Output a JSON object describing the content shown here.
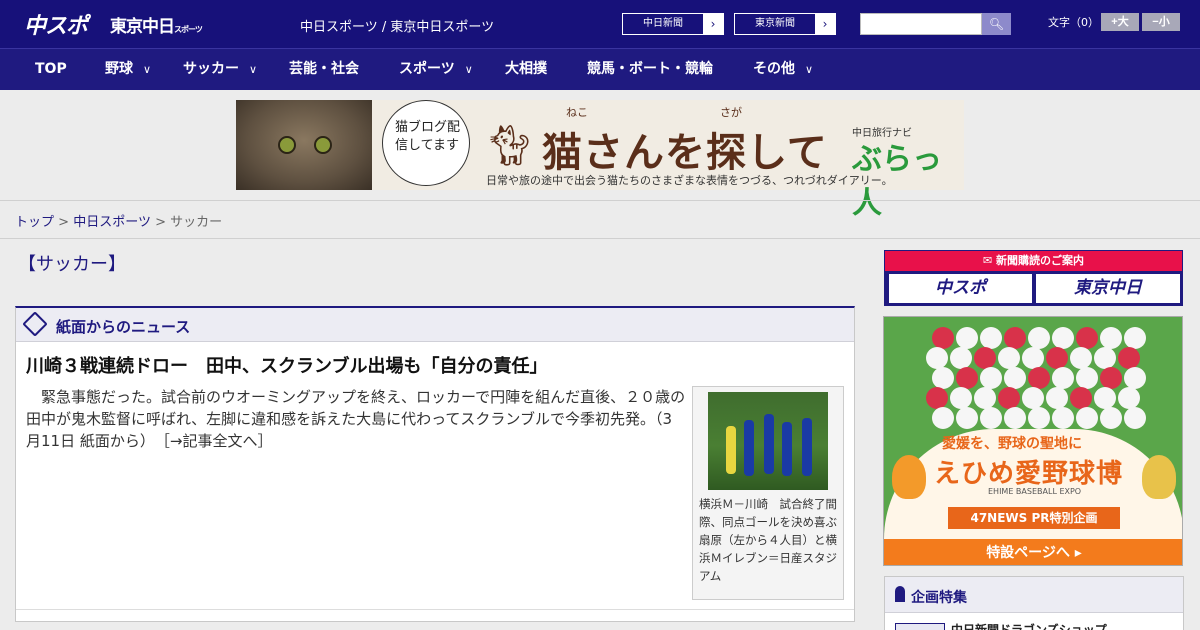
{
  "header": {
    "logo_main": "中スポ",
    "logo_tokyo": "東京中日",
    "logo_tokyo_sub": "スポーツ",
    "site_title": "中日スポーツ / 東京中日スポーツ",
    "links": [
      {
        "label": "中日新聞",
        "arrow": "›"
      },
      {
        "label": "東京新聞",
        "arrow": "›"
      }
    ],
    "search_icon": "search-icon",
    "font_size_label": "文字（0）",
    "font_plus": "+大",
    "font_minus": "−小",
    "brand_color": "#17117a"
  },
  "nav": {
    "items": [
      {
        "label": "TOP",
        "has_dropdown": false
      },
      {
        "label": "野球",
        "has_dropdown": true
      },
      {
        "label": "サッカー",
        "has_dropdown": true
      },
      {
        "label": "芸能・社会",
        "has_dropdown": false
      },
      {
        "label": "スポーツ",
        "has_dropdown": true
      },
      {
        "label": "大相撲",
        "has_dropdown": false
      },
      {
        "label": "競馬・ボート・競輪",
        "has_dropdown": false
      },
      {
        "label": "その他",
        "has_dropdown": true
      }
    ],
    "chevron": "∨"
  },
  "ad_banner": {
    "bubble_text": "猫ブログ配信してます",
    "title": "猫さんを探して",
    "ruby_neko": "ねこ",
    "ruby_saga": "さが",
    "brand_small": "中日旅行ナビ",
    "brand": "ぶらっ人",
    "subtitle": "日常や旅の途中で出会う猫たちのさまざまな表情をつづる、つれづれダイアリー。"
  },
  "breadcrumb": {
    "items": [
      "トップ",
      "中日スポーツ",
      "サッカー"
    ],
    "separator": ">"
  },
  "page_title": "【サッカー】",
  "news_panel": {
    "heading": "紙面からのニュース",
    "headline": "川崎３戦連続ドロー　田中、スクランブル出場も「自分の責任」",
    "body": "緊急事態だった。試合前のウオーミングアップを終え、ロッカーで円陣を組んだ直後、２０歳の田中が鬼木監督に呼ばれ、左脚に違和感を訴えた大島に代わってスクランブルで今季初先発。（3月11日 紙面から）",
    "more_link": "［→記事全文へ］",
    "photo_caption": "横浜Ｍ－川崎　試合終了間際、同点ゴールを決め喜ぶ扇原（左から４人目）と横浜Ｍイレブン＝日産スタジアム"
  },
  "sidebar": {
    "subscribe": {
      "heading": "新聞購読のご案内",
      "buttons": [
        "中スポ",
        "東京中日"
      ],
      "accent": "#e8114a"
    },
    "expo_ad": {
      "tagline": "愛媛を、野球の聖地に",
      "title": "えひめ愛野球博",
      "title_en": "EHIME BASEBALL EXPO",
      "pr": "47NEWS PR特別企画",
      "cta": "特設ページへ ▸",
      "accent": "#f37b1c"
    },
    "features": {
      "heading": "企画特集",
      "first_item": "中日新聞ドラゴンズショップ"
    }
  }
}
